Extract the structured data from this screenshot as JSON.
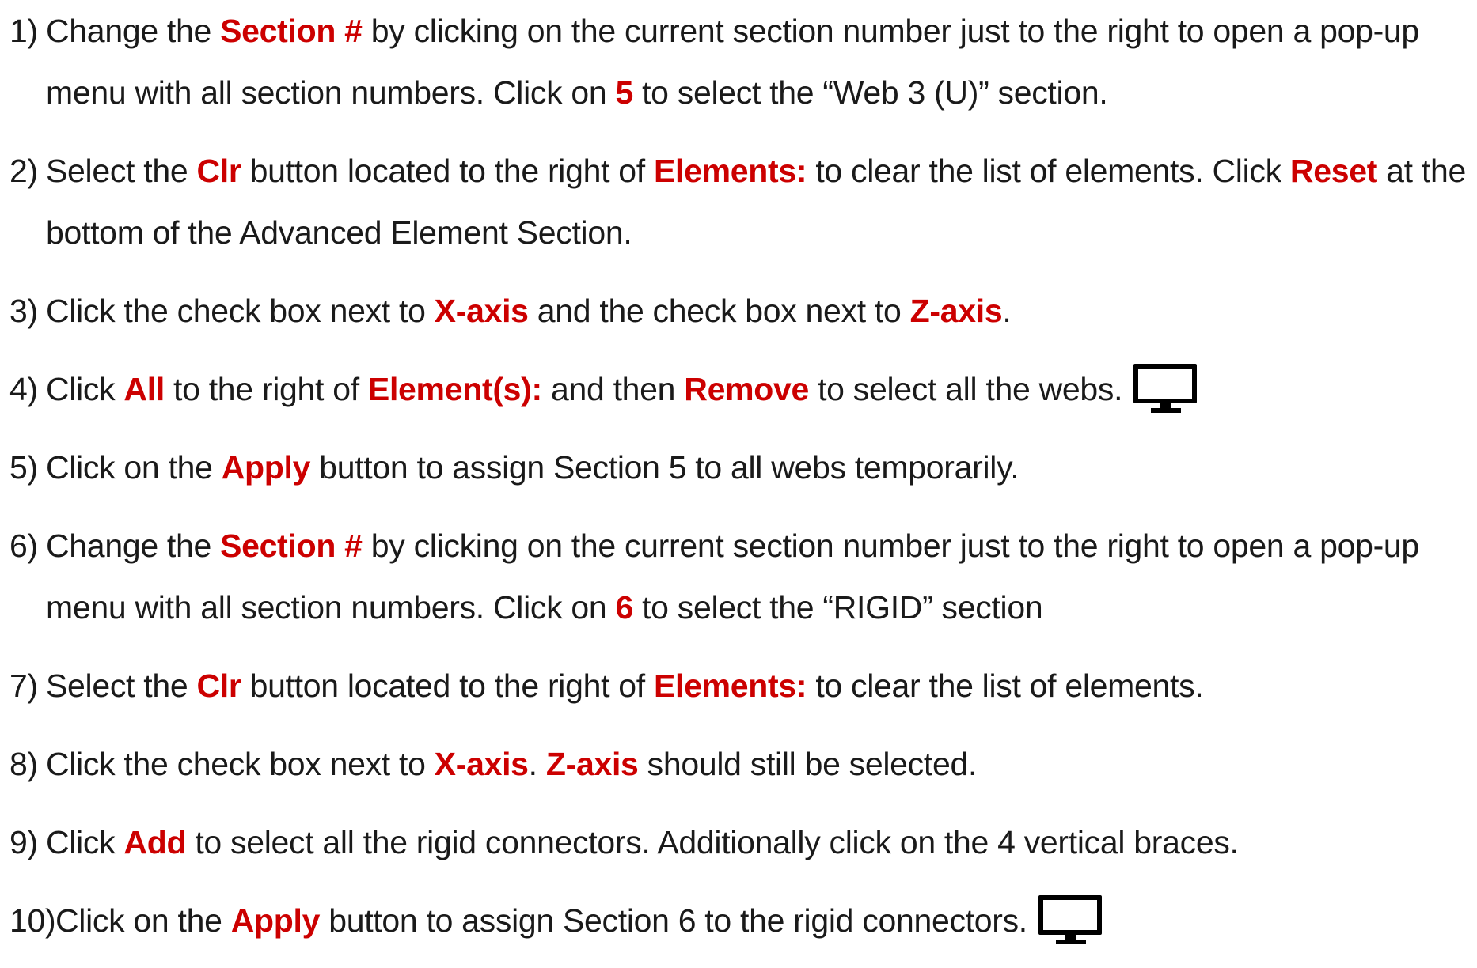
{
  "steps": [
    {
      "num": "1)",
      "segments": [
        {
          "t": "Change the "
        },
        {
          "t": "Section #",
          "hl": true
        },
        {
          "t": " by clicking on the current section number just to the right to open a pop-up menu with all section numbers. Click on "
        },
        {
          "t": "5",
          "hl": true
        },
        {
          "t": " to select the “Web 3 (U)” section."
        }
      ]
    },
    {
      "num": "2)",
      "segments": [
        {
          "t": "Select the "
        },
        {
          "t": "Clr",
          "hl": true
        },
        {
          "t": " button located to the right of "
        },
        {
          "t": "Elements:",
          "hl": true
        },
        {
          "t": " to clear the list of elements. Click "
        },
        {
          "t": "Reset",
          "hl": true
        },
        {
          "t": " at the bottom of the Advanced Element Section."
        }
      ]
    },
    {
      "num": "3)",
      "segments": [
        {
          "t": "Click the check box next to "
        },
        {
          "t": "X-axis",
          "hl": true
        },
        {
          "t": " and the check box next to "
        },
        {
          "t": "Z-axis",
          "hl": true
        },
        {
          "t": "."
        }
      ]
    },
    {
      "num": "4)",
      "icon": "monitor-icon",
      "segments": [
        {
          "t": "Click "
        },
        {
          "t": "All",
          "hl": true
        },
        {
          "t": " to the right of "
        },
        {
          "t": "Element(s):",
          "hl": true
        },
        {
          "t": " and then "
        },
        {
          "t": "Remove",
          "hl": true
        },
        {
          "t": " to select all the webs."
        }
      ]
    },
    {
      "num": "5)",
      "segments": [
        {
          "t": "Click on the "
        },
        {
          "t": "Apply",
          "hl": true
        },
        {
          "t": " button to assign Section 5 to all webs temporarily."
        }
      ]
    },
    {
      "num": "6)",
      "segments": [
        {
          "t": "Change the "
        },
        {
          "t": "Section #",
          "hl": true
        },
        {
          "t": " by clicking on the current section number just to the right to open a pop-up menu with all section numbers. Click on "
        },
        {
          "t": "6",
          "hl": true
        },
        {
          "t": " to select the “RIGID” section"
        }
      ]
    },
    {
      "num": "7)",
      "segments": [
        {
          "t": "Select the "
        },
        {
          "t": "Clr",
          "hl": true
        },
        {
          "t": " button located to the right of "
        },
        {
          "t": "Elements:",
          "hl": true
        },
        {
          "t": " to clear the list of elements."
        }
      ]
    },
    {
      "num": "8)",
      "segments": [
        {
          "t": "Click the check box next to "
        },
        {
          "t": "X-axis",
          "hl": true
        },
        {
          "t": ". "
        },
        {
          "t": "Z-axis",
          "hl": true
        },
        {
          "t": " should still be selected."
        }
      ]
    },
    {
      "num": "9)",
      "segments": [
        {
          "t": "Click "
        },
        {
          "t": "Add",
          "hl": true
        },
        {
          "t": " to select all the rigid connectors. Additionally click on the 4 vertical braces."
        }
      ]
    },
    {
      "num": "10)",
      "icon": "monitor-icon",
      "segments": [
        {
          "t": "Click on the "
        },
        {
          "t": "Apply",
          "hl": true
        },
        {
          "t": " button to assign Section 6 to the rigid connectors."
        }
      ]
    }
  ],
  "colors": {
    "highlight": "#cc0000",
    "text": "#1a1a1a"
  }
}
